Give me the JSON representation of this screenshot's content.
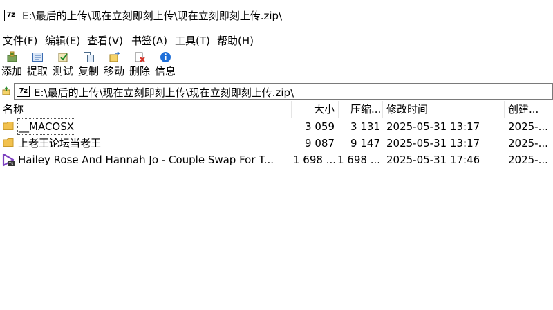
{
  "window": {
    "app_icon_text": "7z",
    "title": "E:\\最后的上传\\现在立刻即刻上传\\现在立刻即刻上传.zip\\"
  },
  "menu": [
    "文件(F)",
    "编辑(E)",
    "查看(V)",
    "书签(A)",
    "工具(T)",
    "帮助(H)"
  ],
  "toolbar": {
    "add": "添加",
    "extract": "提取",
    "test": "测试",
    "copy": "复制",
    "move": "移动",
    "delete": "删除",
    "info": "信息"
  },
  "address": {
    "icon_text": "7z",
    "path": "E:\\最后的上传\\现在立刻即刻上传\\现在立刻即刻上传.zip\\"
  },
  "columns": {
    "name": "名称",
    "size": "大小",
    "packed": "压缩...",
    "modified": "修改时间",
    "created": "创建..."
  },
  "rows": [
    {
      "name": "__MACOSX",
      "size": "3 059",
      "packed": "3 131",
      "modified": "2025-05-31 13:17",
      "created": "2025-...",
      "icon": "folder-icon"
    },
    {
      "name": "上老王论坛当老王",
      "size": "9 087",
      "packed": "9 147",
      "modified": "2025-05-31 13:17",
      "created": "2025-...",
      "icon": "folder-icon"
    },
    {
      "name": "Hailey Rose And Hannah Jo - Couple Swap For T...",
      "size": "1 698 ...",
      "packed": "1 698 ...",
      "modified": "2025-05-31 17:46",
      "created": "2025-...",
      "icon": "video-file-icon"
    }
  ],
  "colors": {
    "folder": "#f2c14e",
    "video_accent": "#7b3fbf",
    "info_blue": "#1e6fd9",
    "delete_red": "#d93025"
  }
}
